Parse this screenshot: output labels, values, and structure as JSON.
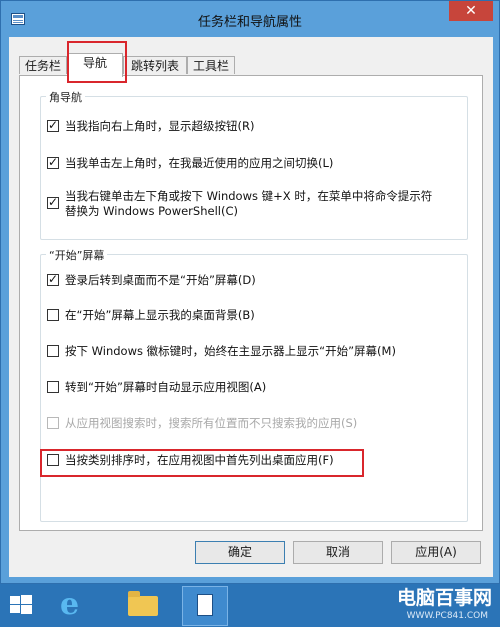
{
  "window": {
    "title": "任务栏和导航属性",
    "close_glyph": "✕"
  },
  "tabs": [
    {
      "label": "任务栏"
    },
    {
      "label": "导航"
    },
    {
      "label": "跳转列表"
    },
    {
      "label": "工具栏"
    }
  ],
  "corner_nav": {
    "title": "角导航",
    "options": [
      {
        "label": "当我指向右上角时，显示超级按钮(R)",
        "checked": true
      },
      {
        "label": "当我单击左上角时，在我最近使用的应用之间切换(L)",
        "checked": true
      },
      {
        "label_line1": "当我右键单击左下角或按下 Windows 键+X 时，在菜单中将命令提示符",
        "label_line2": "替换为 Windows PowerShell(C)",
        "checked": true
      }
    ]
  },
  "start_screen": {
    "title": "“开始”屏幕",
    "options": [
      {
        "label": "登录后转到桌面而不是“开始”屏幕(D)",
        "checked": true
      },
      {
        "label": "在“开始”屏幕上显示我的桌面背景(B)",
        "checked": false
      },
      {
        "label": "按下 Windows 徽标键时，始终在主显示器上显示“开始”屏幕(M)",
        "checked": false
      },
      {
        "label": "转到“开始”屏幕时自动显示应用视图(A)",
        "checked": false
      },
      {
        "label": "从应用视图搜索时，搜索所有位置而不只搜索我的应用(S)",
        "checked": false,
        "disabled": true
      },
      {
        "label": "当按类别排序时，在应用视图中首先列出桌面应用(F)",
        "checked": false
      }
    ]
  },
  "buttons": {
    "ok": "确定",
    "cancel": "取消",
    "apply": "应用(A)"
  },
  "taskbar": {
    "items": [
      "windows-logo",
      "internet-explorer",
      "file-explorer",
      "taskbar-properties"
    ],
    "watermark": "电脑百事网",
    "watermark_sub": "WWW.PC841.COM"
  },
  "colors": {
    "highlight": "#d9262c",
    "titlebar": "#5aa0da",
    "taskbar": "#2b74b7"
  }
}
